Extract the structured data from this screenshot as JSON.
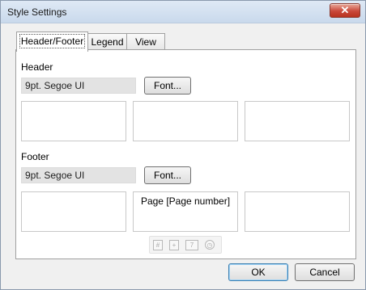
{
  "window": {
    "title": "Style Settings",
    "close_symbol": "✕"
  },
  "tabs": [
    {
      "label": "Header/Footer",
      "active": true
    },
    {
      "label": "Legend",
      "active": false
    },
    {
      "label": "View",
      "active": false
    }
  ],
  "header": {
    "label": "Header",
    "font_value": "9pt. Segoe UI",
    "font_button": "Font...",
    "boxes": [
      "",
      "",
      ""
    ]
  },
  "footer": {
    "label": "Footer",
    "font_value": "9pt. Segoe UI",
    "font_button": "Font...",
    "boxes": [
      "",
      "Page [Page number]",
      ""
    ]
  },
  "insert_toolbar": {
    "icons": [
      "page-number-icon",
      "total-pages-icon",
      "date-icon",
      "time-icon"
    ],
    "glyphs": [
      "#",
      "+",
      "7",
      "◷"
    ]
  },
  "buttons": {
    "ok": "OK",
    "cancel": "Cancel"
  }
}
